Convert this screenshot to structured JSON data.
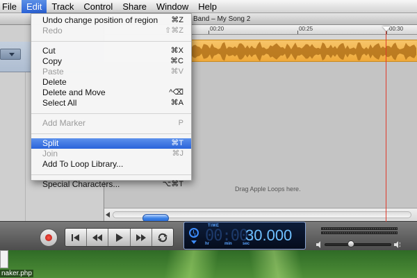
{
  "menubar": {
    "items": [
      "File",
      "Edit",
      "Track",
      "Control",
      "Share",
      "Window",
      "Help"
    ],
    "open_index": 1
  },
  "window": {
    "title": "Band – My Song 2",
    "ruler_labels": [
      "00:20",
      "00:25",
      "00:30"
    ],
    "hint": "Drag Apple Loops here."
  },
  "edit_menu": {
    "items": [
      {
        "label": "Undo change position of region",
        "shortcut": "⌘Z",
        "enabled": true
      },
      {
        "label": "Redo",
        "shortcut": "⇧⌘Z",
        "enabled": false
      },
      {
        "label": "Cut",
        "shortcut": "⌘X",
        "enabled": true
      },
      {
        "label": "Copy",
        "shortcut": "⌘C",
        "enabled": true
      },
      {
        "label": "Paste",
        "shortcut": "⌘V",
        "enabled": false
      },
      {
        "label": "Delete",
        "shortcut": "",
        "enabled": true
      },
      {
        "label": "Delete and Move",
        "shortcut": "^⌫",
        "enabled": true
      },
      {
        "label": "Select All",
        "shortcut": "⌘A",
        "enabled": true
      },
      {
        "label": "Add Marker",
        "shortcut": "P",
        "enabled": false
      },
      {
        "label": "Split",
        "shortcut": "⌘T",
        "enabled": true,
        "highlighted": true
      },
      {
        "label": "Join",
        "shortcut": "⌘J",
        "enabled": false
      },
      {
        "label": "Add To Loop Library...",
        "shortcut": "",
        "enabled": true
      },
      {
        "label": "Special Characters...",
        "shortcut": "⌥⌘T",
        "enabled": true
      }
    ]
  },
  "transport": {
    "lcd_label": "TIME",
    "lcd_dim": "00:00:",
    "lcd_value": "30.000",
    "lcd_units": [
      "hr",
      "min",
      "sec"
    ]
  },
  "desktop": {
    "file_label": "naker.php"
  },
  "colors": {
    "menu_highlight": "#2a63da",
    "region": "#efa93a",
    "playhead": "#e03a2a",
    "lcd_text": "#6fc0ff"
  },
  "icons": [
    "record-icon",
    "go-to-start-icon",
    "rewind-icon",
    "play-icon",
    "fast-forward-icon",
    "cycle-icon",
    "clock-icon",
    "volume-low-icon",
    "volume-high-icon"
  ]
}
